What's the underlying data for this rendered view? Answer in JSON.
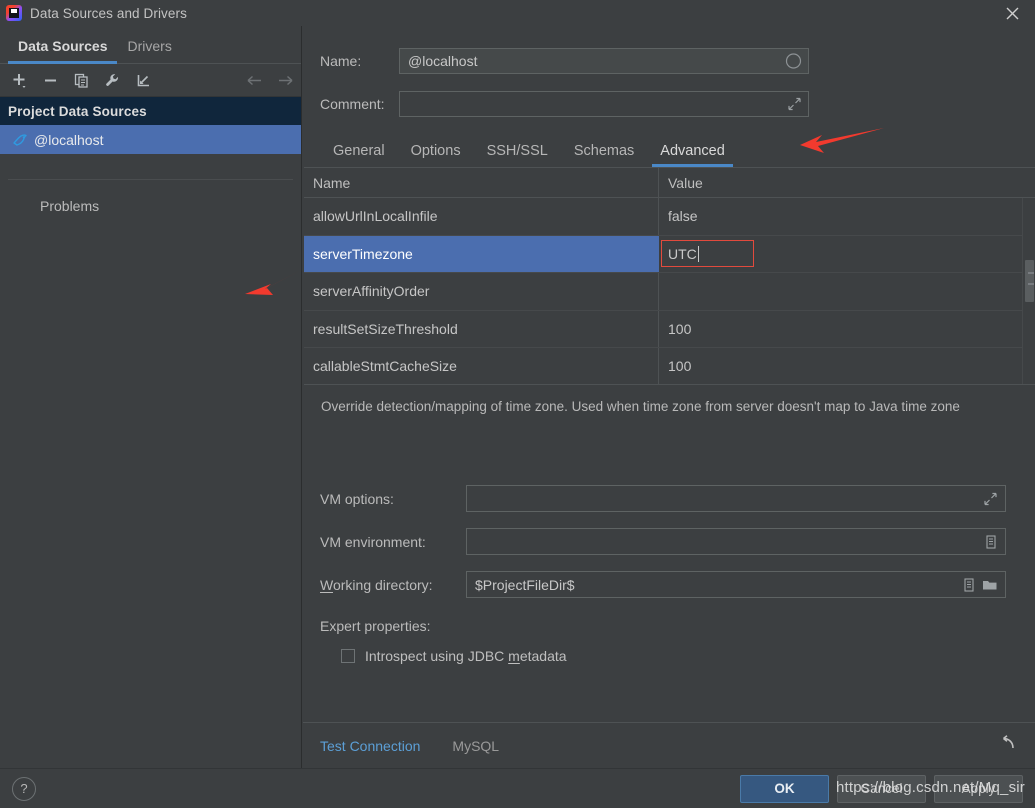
{
  "window": {
    "title": "Data Sources and Drivers",
    "app_icon": "intellij-idea-icon",
    "close_label": "✕"
  },
  "sidebar": {
    "tabs": [
      {
        "label": "Data Sources",
        "active": true
      },
      {
        "label": "Drivers",
        "active": false
      }
    ],
    "toolbar": [
      {
        "name": "add-icon",
        "tooltip": "Add"
      },
      {
        "name": "remove-icon",
        "tooltip": "Remove"
      },
      {
        "name": "copy-icon",
        "tooltip": "Duplicate"
      },
      {
        "name": "wrench-icon",
        "tooltip": "Properties"
      },
      {
        "name": "import-icon",
        "tooltip": "Import"
      },
      {
        "name": "arrow-left-icon",
        "tooltip": "Back"
      },
      {
        "name": "arrow-right-icon",
        "tooltip": "Forward"
      }
    ],
    "group_header": "Project Data Sources",
    "items": [
      {
        "label": "@localhost",
        "icon": "mysql-dolphin-icon",
        "selected": true
      }
    ],
    "problems_label": "Problems"
  },
  "form": {
    "name_label": "Name:",
    "name_value": "@localhost",
    "name_adorn_icon": "color-circle-icon",
    "comment_label": "Comment:",
    "comment_value": "",
    "comment_adorn_icon": "expand-icon"
  },
  "tabs": [
    {
      "label": "General",
      "active": false
    },
    {
      "label": "Options",
      "active": false
    },
    {
      "label": "SSH/SSL",
      "active": false
    },
    {
      "label": "Schemas",
      "active": false
    },
    {
      "label": "Advanced",
      "active": true
    }
  ],
  "properties_table": {
    "columns": [
      "Name",
      "Value"
    ],
    "rows": [
      {
        "name": "allowUrlInLocalInfile",
        "value": "false",
        "selected": false,
        "editing": false
      },
      {
        "name": "serverTimezone",
        "value": "UTC",
        "selected": true,
        "editing": true
      },
      {
        "name": "serverAffinityOrder",
        "value": "",
        "selected": false,
        "editing": false
      },
      {
        "name": "resultSetSizeThreshold",
        "value": "100",
        "selected": false,
        "editing": false
      },
      {
        "name": "callableStmtCacheSize",
        "value": "100",
        "selected": false,
        "editing": false
      }
    ]
  },
  "description": "Override detection/mapping of time zone. Used when time zone from server doesn't map to Java time zone",
  "vm": {
    "options_label": "VM options:",
    "options_value": "",
    "options_adorn_icon": "expand-icon",
    "environment_label": "VM environment:",
    "environment_value": "",
    "environment_adorn_icon": "list-icon",
    "working_dir_label_prefix": "W",
    "working_dir_label_rest": "orking directory:",
    "working_dir_value": "$ProjectFileDir$",
    "working_dir_adorn_icon_1": "list-icon",
    "working_dir_adorn_icon_2": "folder-icon"
  },
  "expert": {
    "label": "Expert properties:",
    "checkbox_prefix": "Introspect using JDBC ",
    "checkbox_mnemonic": "m",
    "checkbox_suffix": "etadata",
    "checked": false
  },
  "test_bar": {
    "test_connection_label": "Test Connection",
    "driver_label": "MySQL",
    "reset_icon": "reset-arrow-icon"
  },
  "bottom_bar": {
    "help_label": "?",
    "buttons": [
      {
        "label": "OK",
        "primary": true
      },
      {
        "label": "Cancel",
        "primary": false
      },
      {
        "label": "Apply",
        "primary": false
      }
    ]
  },
  "annotations": {
    "arrow_1_target": "advanced-tab",
    "arrow_2_target": "serverTimezone-row",
    "arrow_color": "#f23a2e"
  },
  "watermark": "https://blog.csdn.net/Mq_sir",
  "colors": {
    "window_bg": "#3c3f41",
    "selection_blue": "#4b6eaf",
    "group_header_bg": "#10263c",
    "tab_underline": "#4a88c7",
    "link_blue": "#5c9fd6",
    "editor_border_red": "#e24a3d",
    "primary_button": "#365880"
  }
}
